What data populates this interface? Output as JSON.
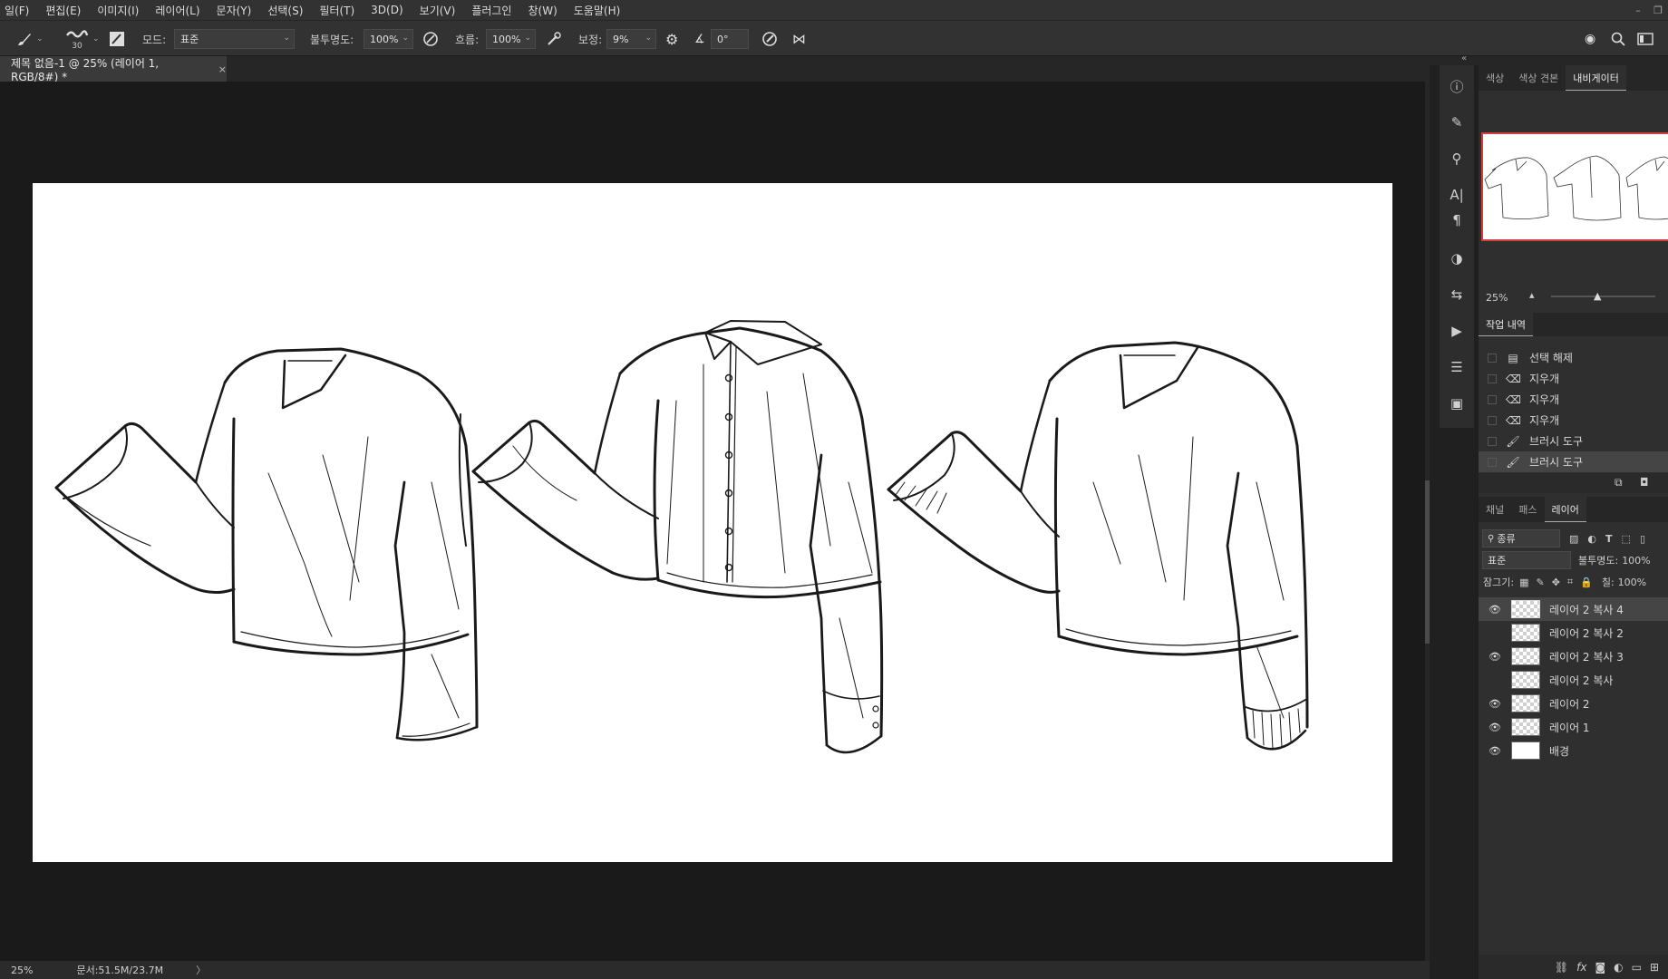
{
  "menu": [
    "일(F)",
    "편집(E)",
    "이미지(I)",
    "레이어(L)",
    "문자(Y)",
    "선택(S)",
    "필터(T)",
    "3D(D)",
    "보기(V)",
    "플러그인",
    "창(W)",
    "도움말(H)"
  ],
  "options": {
    "brush_size": "30",
    "mode_label": "모드:",
    "mode_value": "표준",
    "opacity_label": "불투명도:",
    "opacity_value": "100%",
    "flow_label": "흐름:",
    "flow_value": "100%",
    "smoothing_label": "보정:",
    "smoothing_value": "9%",
    "angle_value": "0°"
  },
  "document": {
    "tab_title": "제목 없음-1 @ 25% (레이어 1, RGB/8#) *",
    "close": "×"
  },
  "status": {
    "zoom": "25%",
    "doc_size": "문서:51.5M/23.7M",
    "arrow": "〉"
  },
  "panels": {
    "top_tabs": [
      "색상",
      "색상 견본",
      "내비게이터"
    ],
    "active_top_tab": "내비게이터",
    "nav_zoom": "25%",
    "history_tab": "작업 내역",
    "history_items": [
      {
        "icon": "document-icon",
        "label": "선택 해제"
      },
      {
        "icon": "eraser-icon",
        "label": "지우개"
      },
      {
        "icon": "eraser-icon",
        "label": "지우개"
      },
      {
        "icon": "eraser-icon",
        "label": "지우개"
      },
      {
        "icon": "brush-icon",
        "label": "브러시 도구"
      },
      {
        "icon": "brush-icon",
        "label": "브러시 도구"
      }
    ],
    "layer_tabs": [
      "채널",
      "패스",
      "레이어"
    ],
    "active_layer_tab": "레이어",
    "filter_label": "종류",
    "blend_mode": "표준",
    "opacity_label": "불투명도:",
    "opacity_value": "100%",
    "lock_label": "잠그기:",
    "fill_label": "칠:",
    "fill_value": "100%",
    "layers": [
      {
        "name": "레이어 2 복사 4",
        "visible": true,
        "selected": true
      },
      {
        "name": "레이어 2 복사 2",
        "visible": false,
        "selected": false
      },
      {
        "name": "레이어 2 복사 3",
        "visible": true,
        "selected": false
      },
      {
        "name": "레이어 2 복사",
        "visible": false,
        "selected": false
      },
      {
        "name": "레이어 2",
        "visible": true,
        "selected": false
      },
      {
        "name": "레이어 1",
        "visible": true,
        "selected": false
      },
      {
        "name": "배경",
        "visible": true,
        "selected": false
      }
    ],
    "bottom_fx": "fx"
  },
  "colors": {
    "accent_nav_border": "#d04040",
    "canvas": "#ffffff",
    "workspace": "#1a1a1a"
  }
}
